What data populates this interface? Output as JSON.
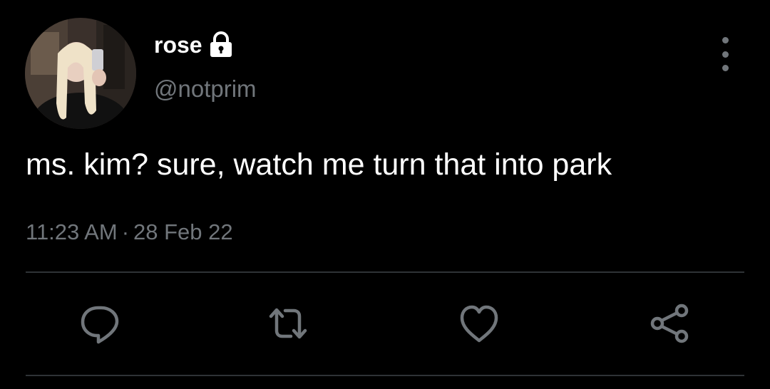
{
  "tweet": {
    "display_name": "rose",
    "handle": "@notprim",
    "text": "ms. kim? sure, watch me turn that into park",
    "time": "11:23 AM",
    "separator": "·",
    "date": "28 Feb 22",
    "protected": true
  },
  "icons": {
    "lock": "lock-icon",
    "more": "more-vertical-icon",
    "reply": "reply-icon",
    "retweet": "retweet-icon",
    "like": "heart-icon",
    "share": "share-icon"
  },
  "colors": {
    "background": "#000000",
    "primary_text": "#ffffff",
    "secondary_text": "#71767b",
    "divider": "#2f3336"
  }
}
